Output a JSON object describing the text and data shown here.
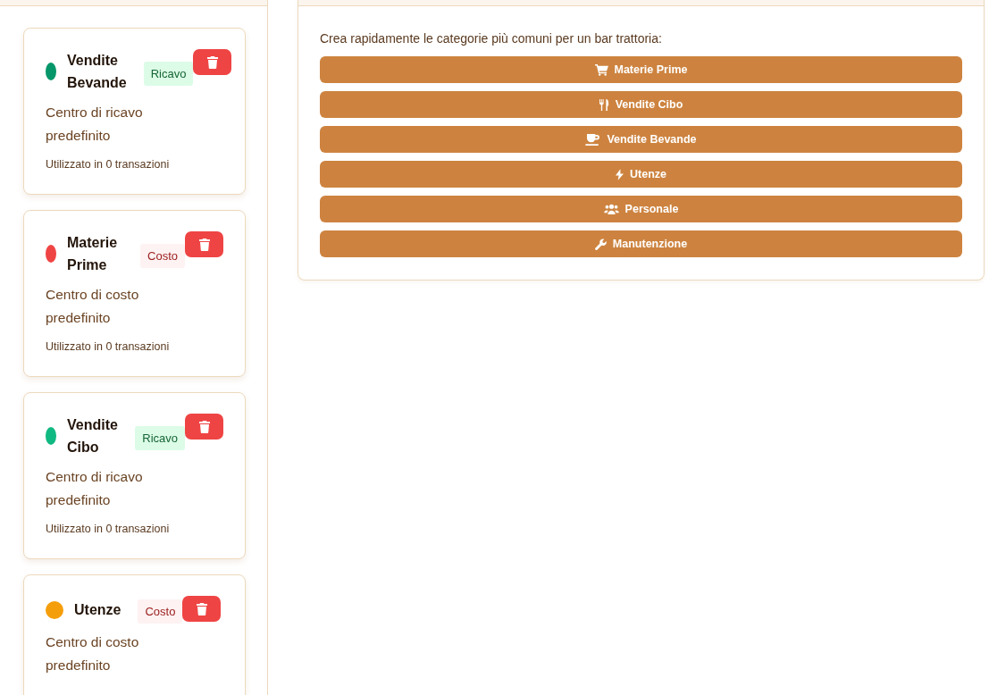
{
  "categories": [
    {
      "name": "Vendite Bevande",
      "color": "#059669",
      "kind": "revenue",
      "badge": "Ricavo",
      "description": "Centro di ricavo predefinito",
      "usage": "Utilizzato in 0 transazioni"
    },
    {
      "name": "Materie Prime",
      "color": "#ef4444",
      "kind": "cost",
      "badge": "Costo",
      "description": "Centro di costo predefinito",
      "usage": "Utilizzato in 0 transazioni"
    },
    {
      "name": "Vendite Cibo",
      "color": "#10b981",
      "kind": "revenue",
      "badge": "Ricavo",
      "description": "Centro di ricavo predefinito",
      "usage": "Utilizzato in 0 transazioni"
    },
    {
      "name": "Utenze",
      "color": "#f59e0b",
      "kind": "cost",
      "badge": "Costo",
      "description": "Centro di costo predefinito"
    }
  ],
  "quick_create": {
    "intro": "Crea rapidamente le categorie più comuni per un bar trattoria:",
    "buttons": [
      {
        "label": "Materie Prime"
      },
      {
        "label": "Vendite Cibo"
      },
      {
        "label": "Vendite Bevande"
      },
      {
        "label": "Utenze"
      },
      {
        "label": "Personale"
      },
      {
        "label": "Manutenzione"
      }
    ]
  }
}
